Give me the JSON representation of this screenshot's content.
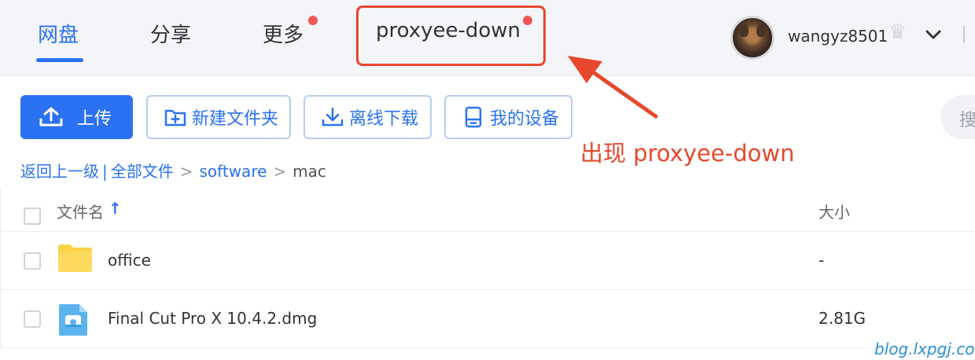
{
  "nav": {
    "tabs": [
      {
        "label": "网盘",
        "active": true
      },
      {
        "label": "分享",
        "active": false
      },
      {
        "label": "更多",
        "active": false,
        "badge": true
      },
      {
        "label": "proxyee-down",
        "active": false,
        "badge": true,
        "highlighted": true
      }
    ],
    "user": {
      "name": "wangyz8501",
      "vip_icon": "crown-icon",
      "menu_icon": "chevron-down-icon"
    }
  },
  "toolbar": {
    "upload_label": "上传",
    "new_folder_label": "新建文件夹",
    "offline_download_label": "离线下载",
    "my_devices_label": "我的设备",
    "search_placeholder": "搜"
  },
  "annotation": {
    "text": "出现 proxyee-down"
  },
  "breadcrumb": {
    "back_label": "返回上一级",
    "items": [
      "全部文件",
      "software",
      "mac"
    ]
  },
  "file_list": {
    "columns": {
      "name": "文件名",
      "size": "大小"
    },
    "rows": [
      {
        "name": "office",
        "size": "-",
        "icon": "folder-icon"
      },
      {
        "name": "Final Cut Pro X 10.4.2.dmg",
        "size": "2.81G",
        "icon": "dmg-icon"
      }
    ]
  },
  "watermark": "blog.lxpgj.com",
  "colors": {
    "accent": "#2a72f2",
    "badge": "#f25656",
    "annotation": "#e8482d",
    "folder": "#fbd348"
  }
}
